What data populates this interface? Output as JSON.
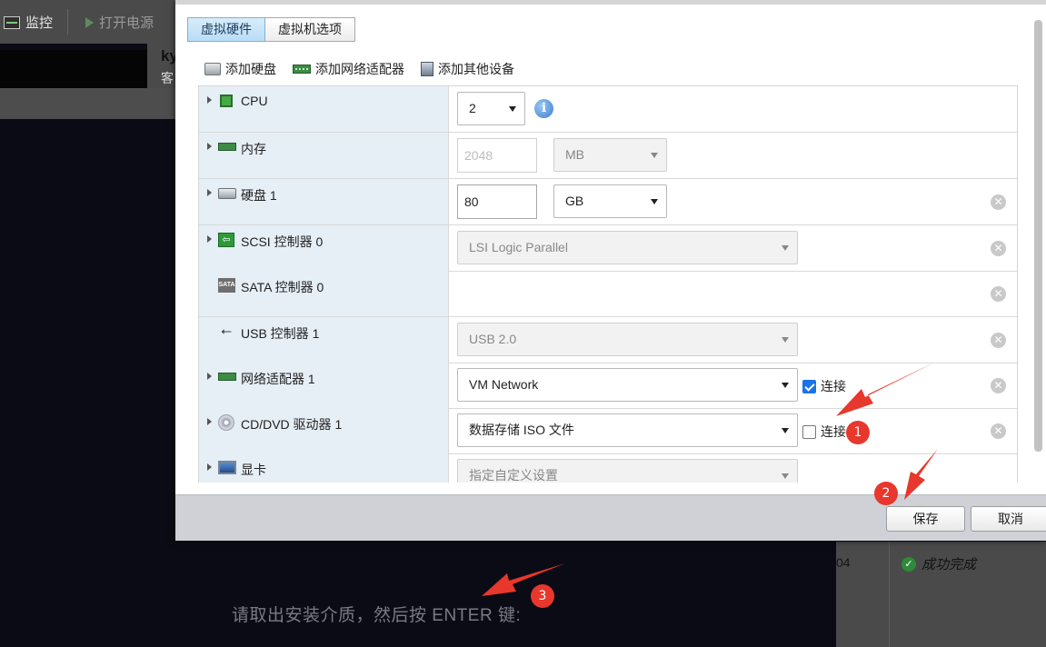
{
  "background": {
    "toolbar": {
      "monitor_label": "监控",
      "power_label": "打开电源"
    },
    "vm_name": "ky",
    "vm_sub": "客",
    "task_number": "04",
    "task_status": "成功完成",
    "console_message": "请取出安装介质，然后按 ENTER 键:"
  },
  "modal": {
    "tabs": [
      {
        "label": "虚拟硬件",
        "active": true
      },
      {
        "label": "虚拟机选项",
        "active": false
      }
    ],
    "add_buttons": {
      "add_disk": "添加硬盘",
      "add_network": "添加网络适配器",
      "add_other": "添加其他设备"
    },
    "rows": {
      "cpu": {
        "name": "CPU",
        "value": "2"
      },
      "memory": {
        "name": "内存",
        "value": "2048",
        "unit": "MB"
      },
      "disk": {
        "name": "硬盘 1",
        "value": "80",
        "unit": "GB"
      },
      "scsi": {
        "name": "SCSI 控制器 0",
        "value": "LSI Logic Parallel"
      },
      "sata": {
        "name": "SATA 控制器 0",
        "icon_text": "SATA"
      },
      "usb": {
        "name": "USB 控制器 1",
        "value": "USB 2.0"
      },
      "network": {
        "name": "网络适配器 1",
        "value": "VM Network",
        "connect_label": "连接",
        "connected": true
      },
      "cddvd": {
        "name": "CD/DVD 驱动器 1",
        "value": "数据存储 ISO 文件",
        "connect_label": "连接",
        "connected": false
      },
      "display": {
        "name": "显卡",
        "value": "指定自定义设置"
      }
    },
    "footer": {
      "save_label": "保存",
      "cancel_label": "取消"
    }
  },
  "annotations": {
    "badge1": "1",
    "badge2": "2",
    "badge3": "3",
    "color": "#e8372c"
  },
  "icons": [
    "monitor-icon",
    "play-icon",
    "disk-icon",
    "network-icon",
    "device-icon",
    "info-icon",
    "remove-icon",
    "check-circle-icon"
  ]
}
